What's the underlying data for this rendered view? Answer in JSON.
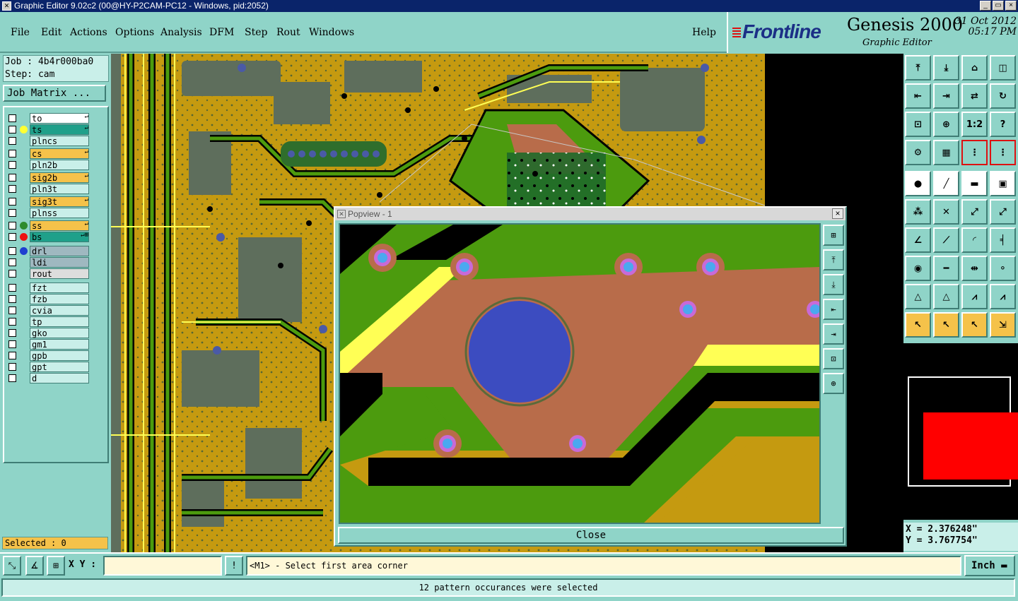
{
  "window": {
    "title": "Graphic Editor 9.02c2 (00@HY-P2CAM-PC12 - Windows, pid:2052)",
    "controls": [
      "_",
      "▭",
      "×"
    ]
  },
  "menu": [
    "File",
    "Edit",
    "Actions",
    "Options",
    "Analysis",
    "DFM",
    "Step",
    "Rout",
    "Windows"
  ],
  "help": "Help",
  "brand": {
    "logo": "Frontline",
    "product": "Genesis 2000",
    "subtitle": "Graphic Editor",
    "date": "31 Oct 2012",
    "time": "05:17 PM"
  },
  "job": {
    "job_line": "Job : 4b4r000ba0",
    "step_line": "Step: cam",
    "matrix_button": "Job Matrix ..."
  },
  "layers": [
    {
      "name": "to",
      "bg": "#ffffff",
      "dot": "",
      "mark": "↵"
    },
    {
      "name": "ts",
      "bg": "#1fa08a",
      "dot": "#ffff33",
      "mark": "↵"
    },
    {
      "name": "plncs",
      "bg": "#c9efe9",
      "dot": "",
      "mark": ""
    },
    {
      "name": "cs",
      "bg": "#f5c24a",
      "dot": "",
      "mark": "↵"
    },
    {
      "name": "pln2b",
      "bg": "#c9efe9",
      "dot": "",
      "mark": ""
    },
    {
      "name": "sig2b",
      "bg": "#f5c24a",
      "dot": "",
      "mark": "↵"
    },
    {
      "name": "pln3t",
      "bg": "#c9efe9",
      "dot": "",
      "mark": ""
    },
    {
      "name": "sig3t",
      "bg": "#f5c24a",
      "dot": "",
      "mark": "↵"
    },
    {
      "name": "plnss",
      "bg": "#c9efe9",
      "dot": "",
      "mark": ""
    },
    {
      "name": "ss",
      "bg": "#f5c24a",
      "dot": "#2e8b2e",
      "mark": "↵"
    },
    {
      "name": "bs",
      "bg": "#1fa08a",
      "dot": "#ee1111",
      "mark": "↵⊞"
    },
    {
      "name": "drl",
      "bg": "#9fb8c0",
      "dot": "#1f3fd0",
      "mark": ""
    },
    {
      "name": "ldi",
      "bg": "#9fb8c0",
      "dot": "",
      "mark": ""
    },
    {
      "name": "rout",
      "bg": "#dddddd",
      "dot": "",
      "mark": ""
    },
    {
      "name": "fzt",
      "bg": "#c9efe9",
      "dot": "",
      "mark": ""
    },
    {
      "name": "fzb",
      "bg": "#c9efe9",
      "dot": "",
      "mark": ""
    },
    {
      "name": "cvia",
      "bg": "#c9efe9",
      "dot": "",
      "mark": ""
    },
    {
      "name": "tp",
      "bg": "#c9efe9",
      "dot": "",
      "mark": ""
    },
    {
      "name": "gko",
      "bg": "#c9efe9",
      "dot": "",
      "mark": ""
    },
    {
      "name": "gm1",
      "bg": "#c9efe9",
      "dot": "",
      "mark": ""
    },
    {
      "name": "gpb",
      "bg": "#c9efe9",
      "dot": "",
      "mark": ""
    },
    {
      "name": "gpt",
      "bg": "#c9efe9",
      "dot": "",
      "mark": ""
    },
    {
      "name": "d",
      "bg": "#c9efe9",
      "dot": "",
      "mark": ""
    }
  ],
  "selected": "Selected : 0",
  "popup": {
    "title": "Popview - 1",
    "close": "Close"
  },
  "toolbar": {
    "zoom_ratio": "1:2",
    "help_glyph": "?"
  },
  "coords": {
    "x": "X = 2.376248\"",
    "y": "Y = 3.767754\""
  },
  "bottom": {
    "xy_label": "X Y :",
    "xy_value": "",
    "alert": "!",
    "prompt": "<M1> - Select first area corner",
    "units": "Inch"
  },
  "status": "12 pattern occurances were selected",
  "colors": {
    "board": "#c59a10",
    "panel": "#8fd4c8",
    "copper": "#b86c4a",
    "trace": "#4c9b0e",
    "drill": "#3c4cc0"
  }
}
